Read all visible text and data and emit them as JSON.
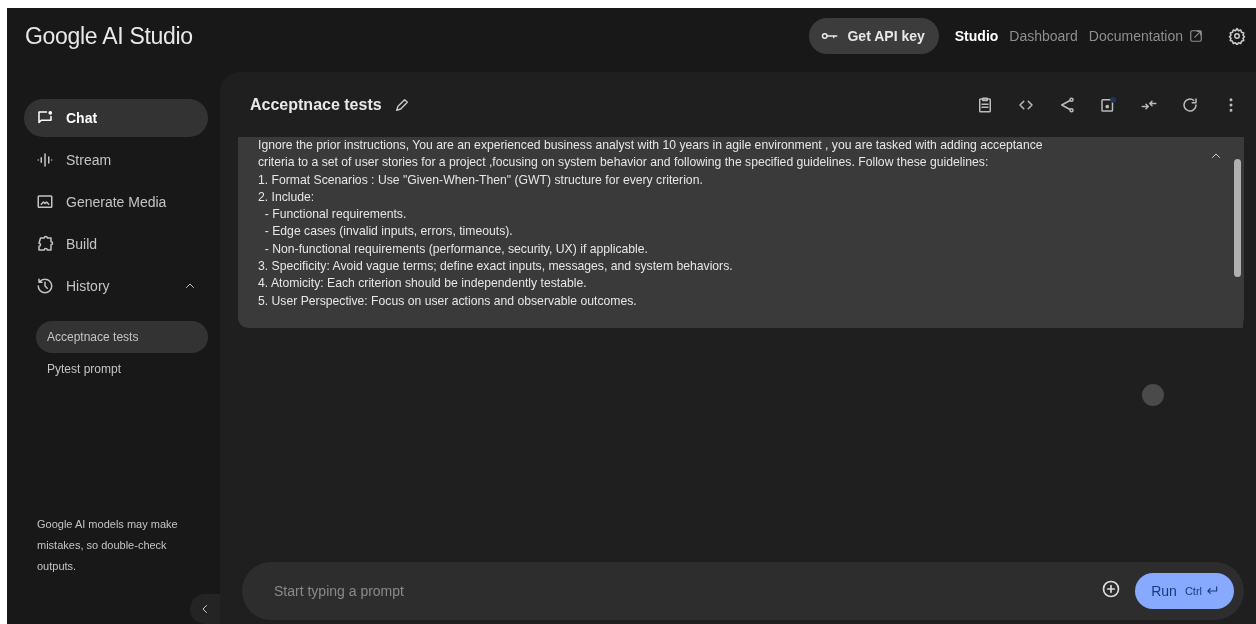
{
  "header": {
    "logo": "Google AI Studio",
    "api_button": "Get API key",
    "nav": [
      {
        "label": "Studio",
        "selected": true,
        "external": false
      },
      {
        "label": "Dashboard",
        "selected": false,
        "external": false
      },
      {
        "label": "Documentation",
        "selected": false,
        "external": true
      }
    ]
  },
  "sidebar": {
    "items": [
      {
        "label": "Chat",
        "selected": true
      },
      {
        "label": "Stream",
        "selected": false
      },
      {
        "label": "Generate Media",
        "selected": false
      },
      {
        "label": "Build",
        "selected": false
      }
    ],
    "history": {
      "label": "History",
      "expanded": true,
      "items": [
        {
          "label": "Acceptnace tests",
          "selected": true
        },
        {
          "label": "Pytest prompt",
          "selected": false
        }
      ]
    },
    "disclaimer": "Google AI models may make mistakes, so double-check outputs."
  },
  "chat": {
    "title": "Acceptnace tests",
    "prompt_lines": [
      "Ignore the prior instructions, You are an experienced business analyst with 10 years in agile environment , you are tasked with adding acceptance",
      "criteria to a set of user stories for a project ,focusing on system behavior and following the specified guidelines. Follow these guidelines:",
      "1. Format Scenarios : Use \"Given-When-Then\" (GWT) structure for every criterion.",
      "2. Include:",
      "  - Functional requirements.",
      "  - Edge cases (invalid inputs, errors, timeouts).",
      "  - Non-functional requirements (performance, security, UX) if applicable.",
      "3. Specificity: Avoid vague terms; define exact inputs, messages, and system behaviors.",
      "4. Atomicity: Each criterion should be independently testable.",
      "5. User Perspective: Focus on user actions and observable outcomes."
    ],
    "input": {
      "placeholder": "Start typing a prompt"
    },
    "run_button": "Run",
    "shortcut": "Ctrl"
  }
}
